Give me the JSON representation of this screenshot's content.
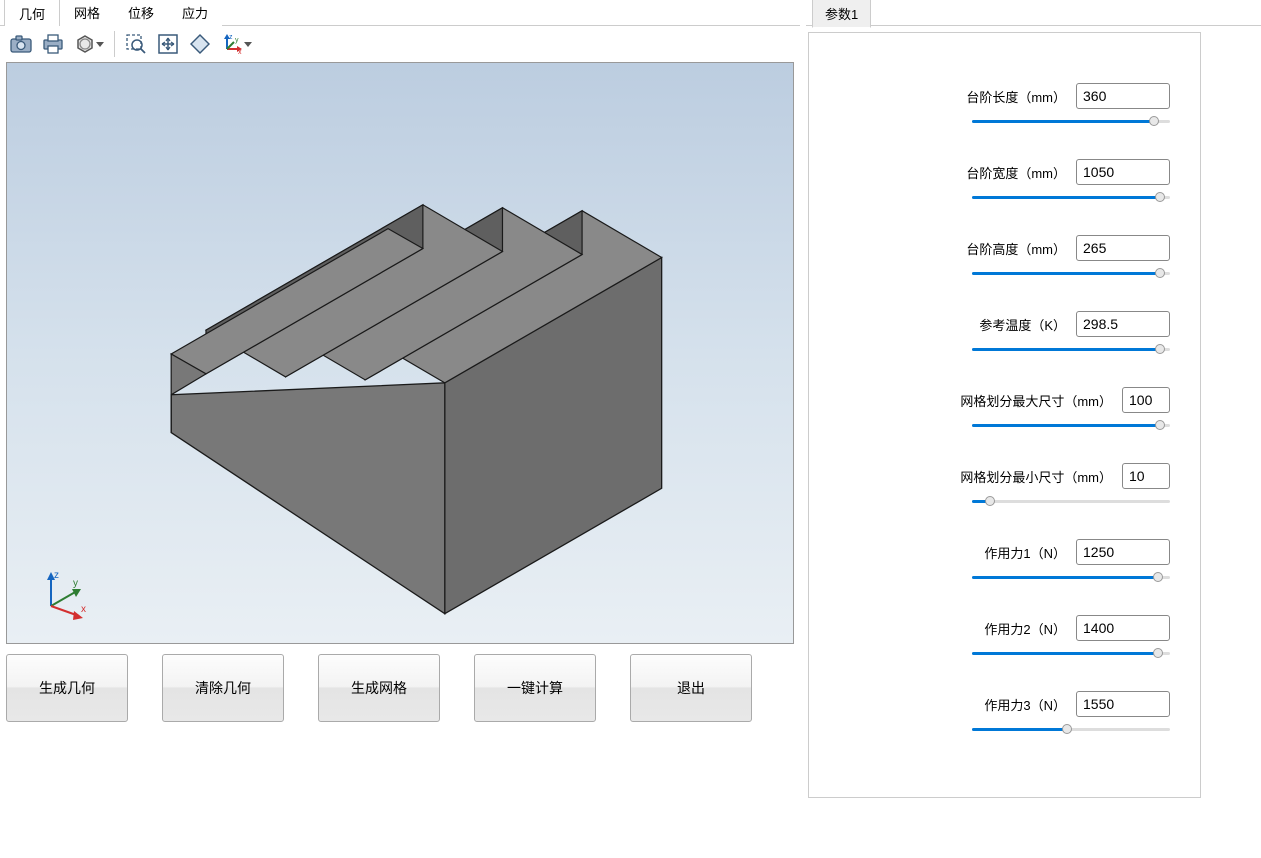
{
  "menu_tabs": {
    "items": [
      {
        "label": "几何",
        "active": true
      },
      {
        "label": "网格",
        "active": false
      },
      {
        "label": "位移",
        "active": false
      },
      {
        "label": "应力",
        "active": false
      }
    ]
  },
  "right_tabs": {
    "items": [
      {
        "label": "参数1",
        "active": true
      }
    ]
  },
  "toolbar": {
    "icons": [
      "camera-icon",
      "print-icon",
      "hexagon-icon",
      "separator",
      "zoom-area-icon",
      "fit-view-icon",
      "xy-plane-icon",
      "axes-icon"
    ]
  },
  "triad": {
    "x": "x",
    "y": "y",
    "z": "z"
  },
  "actions": {
    "buttons": [
      {
        "label": "生成几何"
      },
      {
        "label": "清除几何"
      },
      {
        "label": "生成网格"
      },
      {
        "label": "一键计算"
      },
      {
        "label": "退出"
      }
    ]
  },
  "params": {
    "items": [
      {
        "label": "台阶长度（mm）",
        "value": "360",
        "wide": false,
        "fill_pct": 92
      },
      {
        "label": "台阶宽度（mm）",
        "value": "1050",
        "wide": false,
        "fill_pct": 95
      },
      {
        "label": "台阶高度（mm）",
        "value": "265",
        "wide": false,
        "fill_pct": 95
      },
      {
        "label": "参考温度（K）",
        "value": "298.5",
        "wide": false,
        "fill_pct": 95
      },
      {
        "label": "网格划分最大尺寸（mm）",
        "value": "100",
        "wide": true,
        "fill_pct": 95
      },
      {
        "label": "网格划分最小尺寸（mm）",
        "value": "10",
        "wide": true,
        "fill_pct": 9
      },
      {
        "label": "作用力1（N）",
        "value": "1250",
        "wide": false,
        "fill_pct": 94
      },
      {
        "label": "作用力2（N）",
        "value": "1400",
        "wide": false,
        "fill_pct": 94
      },
      {
        "label": "作用力3（N）",
        "value": "1550",
        "wide": false,
        "fill_pct": 48
      }
    ]
  }
}
